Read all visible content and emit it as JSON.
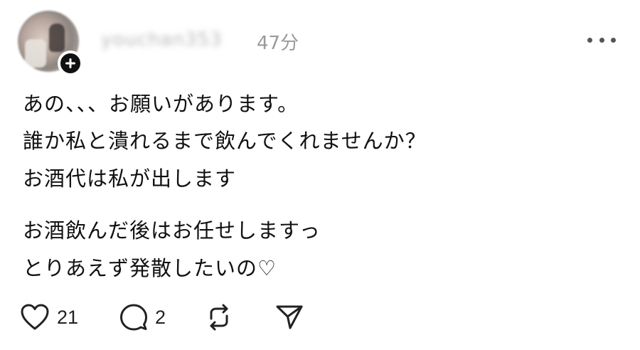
{
  "post": {
    "username": "youchan353",
    "time": "47分",
    "lines": [
      "あの、、、お願いがあります。",
      "誰か私と潰れるまで飲んでくれませんか？",
      "お酒代は私が出します",
      "お酒飲んだ後はお任せしますっ",
      "とりあえず発散したいの♡"
    ],
    "likes": "21",
    "replies": "2"
  },
  "icons": {
    "follow": "plus-icon",
    "more": "more-dots-icon",
    "like": "heart-icon",
    "reply": "comment-icon",
    "repost": "repost-icon",
    "share": "send-icon"
  }
}
